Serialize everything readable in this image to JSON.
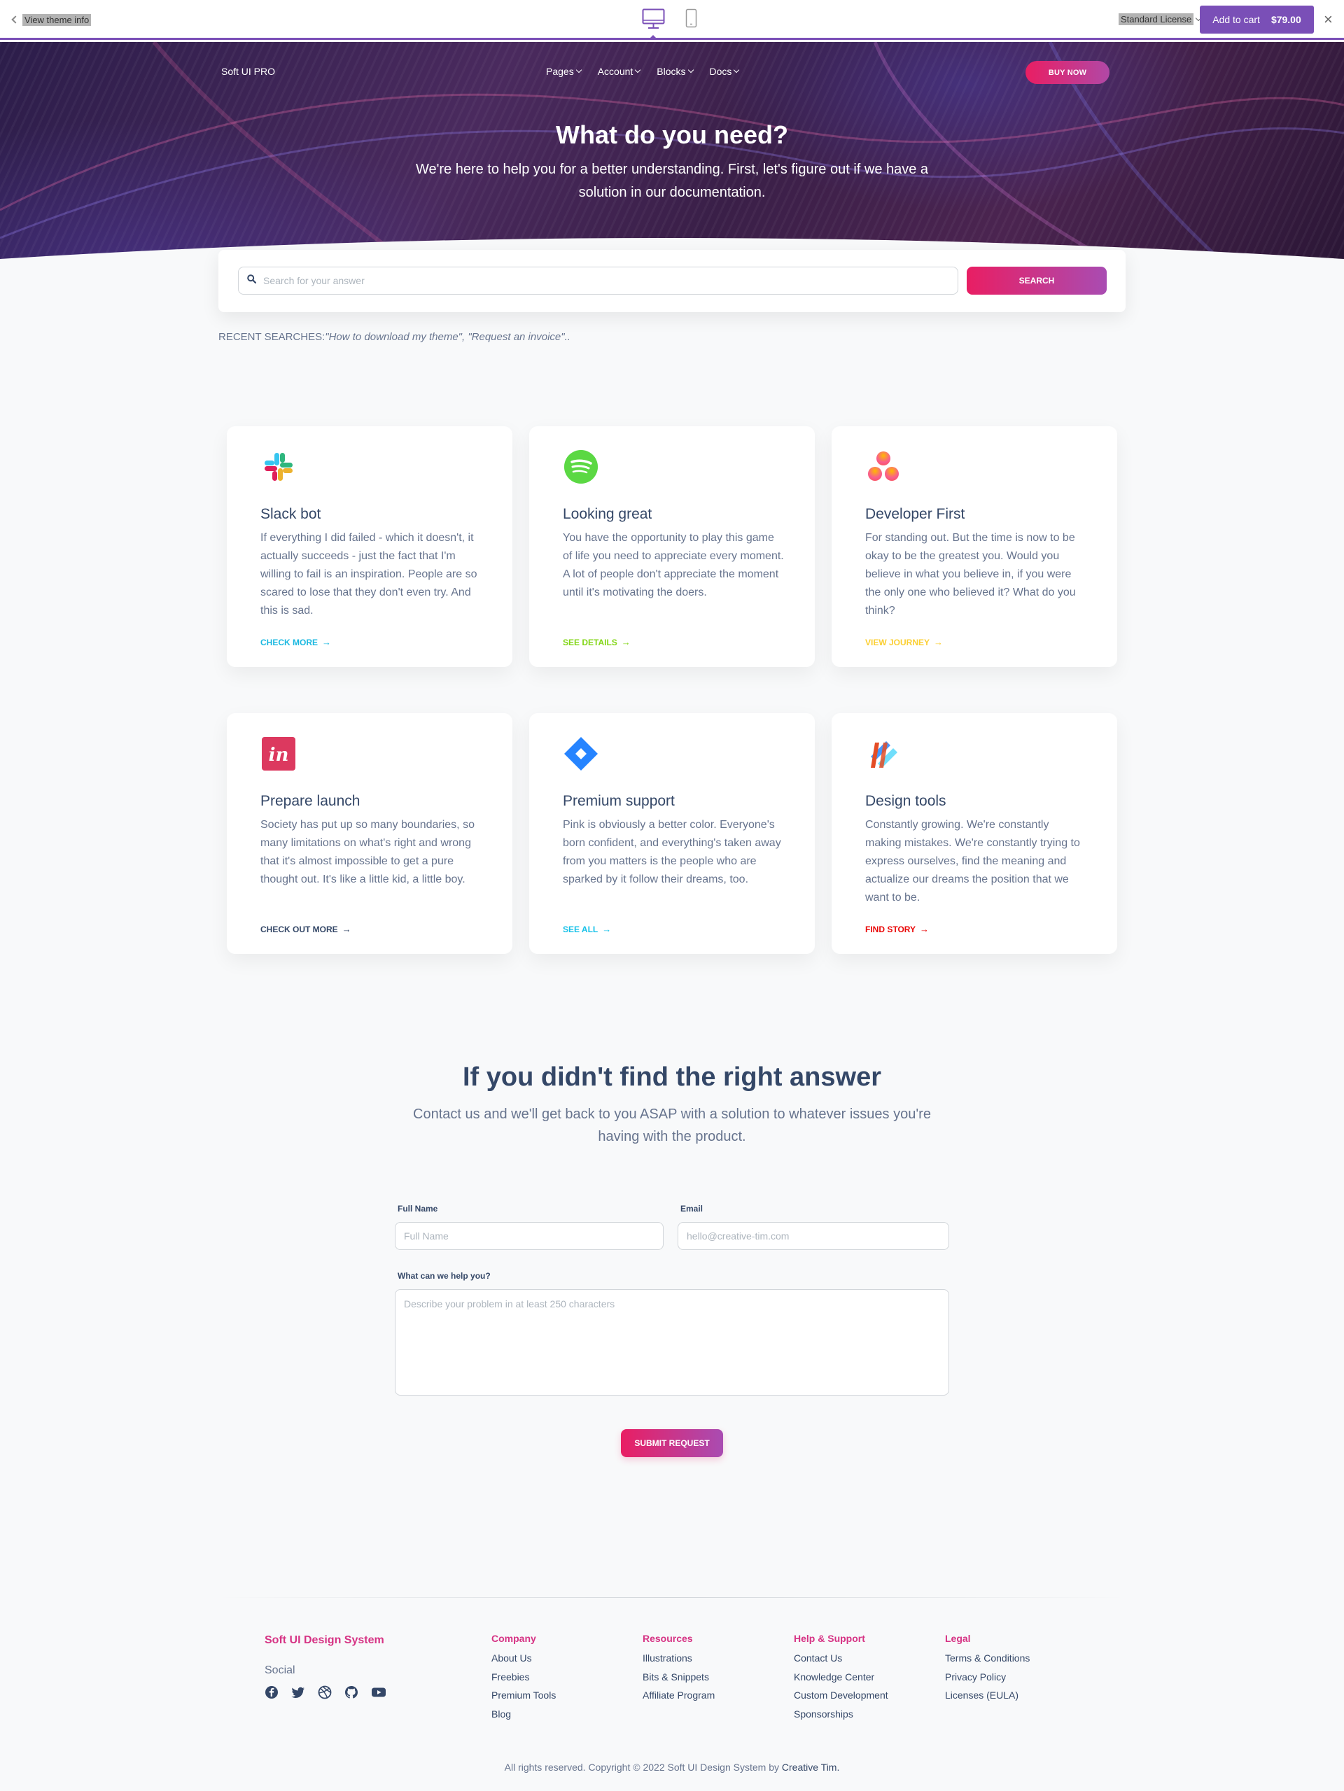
{
  "topbar": {
    "view_info": "View theme info",
    "license": "Standard License",
    "cart_label": "Add to cart",
    "cart_price": "$79.00",
    "close": "×"
  },
  "nav": {
    "brand": "Soft UI PRO",
    "items": [
      "Pages",
      "Account",
      "Blocks",
      "Docs"
    ],
    "buy": "BUY NOW"
  },
  "hero": {
    "title": "What do you need?",
    "subtitle": "We're here to help you for a better understanding. First, let's figure out if we have a solution in our documentation."
  },
  "search": {
    "placeholder": "Search for your answer",
    "button": "SEARCH",
    "recent_label": "Recent searches:",
    "recent_items": "\"How to download my theme\", \"Request an invoice\".."
  },
  "cards": [
    {
      "icon": "slack-icon",
      "title": "Slack bot",
      "text": "If everything I did failed - which it doesn't, it actually succeeds - just the fact that I'm willing to fail is an inspiration. People are so scared to lose that they don't even try. And this is sad.",
      "link": "Check more",
      "color": "#1ab8e0"
    },
    {
      "icon": "spotify-icon",
      "title": "Looking great",
      "text": "You have the opportunity to play this game of life you need to appreciate every moment. A lot of people don't appreciate the moment until it's motivating the doers.",
      "link": "See details",
      "color": "#82d616"
    },
    {
      "icon": "asana-icon",
      "title": "Developer First",
      "text": "For standing out. But the time is now to be okay to be the greatest you. Would you believe in what you believe in, if you were the only one who believed it? What do you think?",
      "link": "View journey",
      "color": "#fbcf33"
    },
    {
      "icon": "invision-icon",
      "title": "Prepare launch",
      "text": "Society has put up so many boundaries, so many limitations on what's right and wrong that it's almost impossible to get a pure thought out. It's like a little kid, a little boy.",
      "link": "Check out more",
      "color": "#344767"
    },
    {
      "icon": "jira-icon",
      "title": "Premium support",
      "text": "Pink is obviously a better color. Everyone's born confident, and everything's taken away from you matters is the people who are sparked by it follow their dreams, too.",
      "link": "See all",
      "color": "#17c1e8"
    },
    {
      "icon": "xd-icon",
      "title": "Design tools",
      "text": "Constantly growing. We're constantly making mistakes. We're constantly trying to express ourselves, find the meaning and actualize our dreams the position that we want to be.",
      "link": "Find story",
      "color": "#ea0606"
    }
  ],
  "contact": {
    "title": "If you didn't find the right answer",
    "subtitle": "Contact us and we'll get back to you ASAP with a solution to whatever issues you're having with the product.",
    "name_label": "Full Name",
    "name_placeholder": "Full Name",
    "email_label": "Email",
    "email_placeholder": "hello@creative-tim.com",
    "help_label": "What can we help you?",
    "help_placeholder": "Describe your problem in at least 250 characters",
    "submit": "SUBMIT REQUEST"
  },
  "footer": {
    "brand": "Soft UI Design System",
    "social_title": "Social",
    "social_icons": [
      "facebook-icon",
      "twitter-icon",
      "dribbble-icon",
      "github-icon",
      "youtube-icon"
    ],
    "columns": [
      {
        "heading": "Company",
        "items": [
          "About Us",
          "Freebies",
          "Premium Tools",
          "Blog"
        ]
      },
      {
        "heading": "Resources",
        "items": [
          "Illustrations",
          "Bits & Snippets",
          "Affiliate Program"
        ]
      },
      {
        "heading": "Help & Support",
        "items": [
          "Contact Us",
          "Knowledge Center",
          "Custom Development",
          "Sponsorships"
        ]
      },
      {
        "heading": "Legal",
        "items": [
          "Terms & Conditions",
          "Privacy Policy",
          "Licenses (EULA)"
        ]
      }
    ],
    "copyright": "All rights reserved. Copyright © 2022 Soft UI Design System by",
    "copyright_link": "Creative Tim."
  }
}
